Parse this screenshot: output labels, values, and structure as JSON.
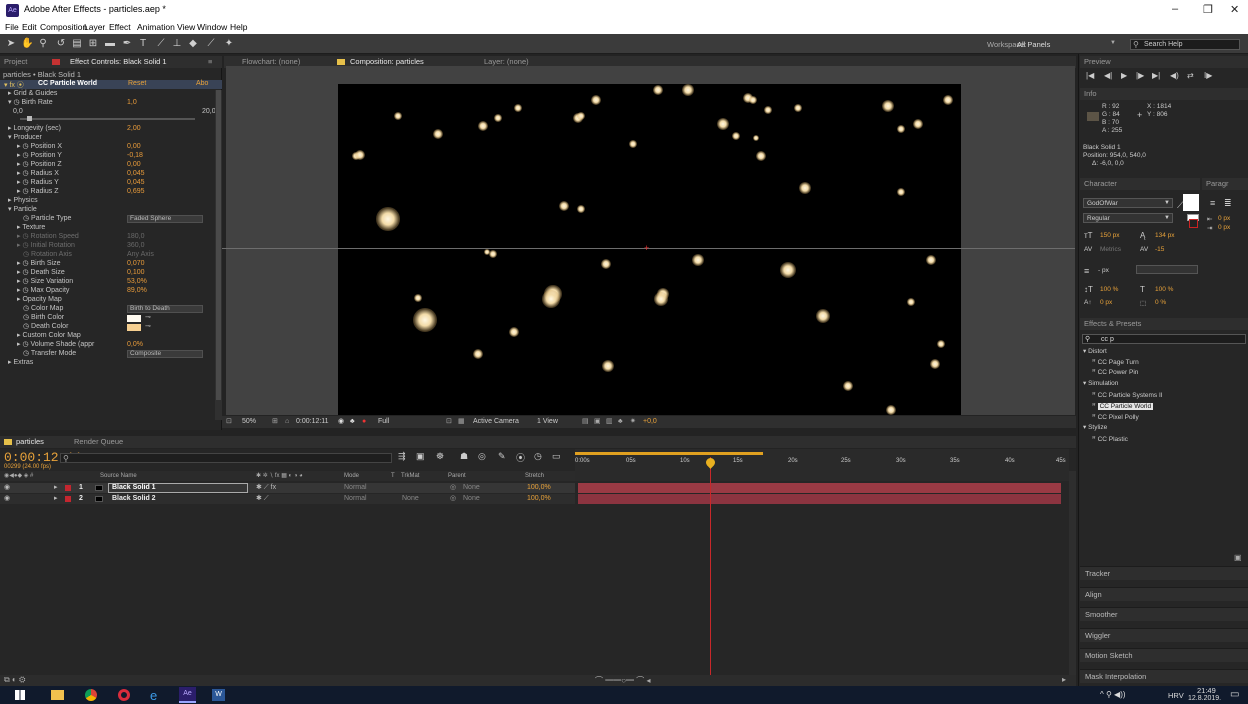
{
  "window": {
    "title": "Adobe After Effects - particles.aep *",
    "minimize": "–",
    "maximize": "❐",
    "close": "✕"
  },
  "menu": [
    "File",
    "Edit",
    "Composition",
    "Layer",
    "Effect",
    "Animation",
    "View",
    "Window",
    "Help"
  ],
  "toolbar": {
    "workspace_label": "Workspace:",
    "workspace_value": "All Panels",
    "search_placeholder": "Search Help"
  },
  "effect_controls": {
    "tab_project": "Project",
    "tab_title": "Effect Controls: Black Solid 1",
    "breadcrumb": "particles • Black Solid 1",
    "effect_name": "CC Particle World",
    "reset": "Reset",
    "about": "Abo",
    "rows": [
      {
        "label": "▸ Grid & Guides",
        "value": ""
      },
      {
        "label": "▾ ◷ Birth Rate",
        "value": "1,0"
      },
      {
        "label": "0,0",
        "value": "20,0"
      },
      {
        "label": "",
        "value": ""
      },
      {
        "label": "▸ Longevity (sec)",
        "value": "2,00"
      },
      {
        "label": "▾ Producer",
        "value": ""
      },
      {
        "label": "▸ ◷ Position X",
        "value": "0,00"
      },
      {
        "label": "▸ ◷ Position Y",
        "value": "-0,18"
      },
      {
        "label": "▸ ◷ Position Z",
        "value": "0,00"
      },
      {
        "label": "▸ ◷ Radius X",
        "value": "0,045"
      },
      {
        "label": "▸ ◷ Radius Y",
        "value": "0,045"
      },
      {
        "label": "▸ ◷ Radius Z",
        "value": "0,695"
      },
      {
        "label": "▸ Physics",
        "value": ""
      },
      {
        "label": "▾ Particle",
        "value": ""
      },
      {
        "label": "◷ Particle Type",
        "value": "Faded Sphere"
      },
      {
        "label": "▸ Texture",
        "value": ""
      },
      {
        "label": "▸ ◷ Rotation Speed",
        "value": "180,0"
      },
      {
        "label": "▸ ◷ Initial Rotation",
        "value": "360,0"
      },
      {
        "label": "◷ Rotation Axis",
        "value": "Any Axis"
      },
      {
        "label": "▸ ◷ Birth Size",
        "value": "0,070"
      },
      {
        "label": "▸ ◷ Death Size",
        "value": "0,100"
      },
      {
        "label": "▸ ◷ Size Variation",
        "value": "53,0%"
      },
      {
        "label": "▸ ◷ Max Opacity",
        "value": "89,0%"
      },
      {
        "label": "▸ Opacity Map",
        "value": ""
      },
      {
        "label": "◷ Color Map",
        "value": "Birth to Death"
      },
      {
        "label": "◷ Birth Color",
        "value": ""
      },
      {
        "label": "◷ Death Color",
        "value": ""
      },
      {
        "label": "▸ Custom Color Map",
        "value": ""
      },
      {
        "label": "▸ ◷ Volume Shade (appr",
        "value": "0,0%"
      },
      {
        "label": "◷ Transfer Mode",
        "value": "Composite"
      },
      {
        "label": "▸ Extras",
        "value": ""
      }
    ],
    "birth_color": "#fffaf0",
    "death_color": "#f6cf90"
  },
  "viewer": {
    "tab_flowchart": "Flowchart: (none)",
    "tab_composition": "Composition: particles",
    "tab_layer": "Layer: (none)",
    "comp_tab": "particles",
    "zoom": "50%",
    "timecode": "0:00:12:11",
    "resolution": "Full",
    "camera": "Active Camera",
    "view": "1 View",
    "exposure": "+0,0"
  },
  "timeline": {
    "tab": "particles",
    "tab_render": "Render Queue",
    "timecode": "0:00:12:11",
    "frames": "00299 (24.00 fps)",
    "col_source": "Source Name",
    "col_mode": "Mode",
    "col_t": "T",
    "col_trkmat": "TrkMat",
    "col_parent": "Parent",
    "col_stretch": "Stretch",
    "ruler": [
      "0:00s",
      "05s",
      "10s",
      "15s",
      "20s",
      "25s",
      "30s",
      "35s",
      "40s",
      "45s"
    ],
    "playhead_seconds": 12.46,
    "layers": [
      {
        "num": "1",
        "name": "Black Solid 1",
        "mode": "Normal",
        "trkmat": "",
        "parent": "None",
        "stretch": "100,0%"
      },
      {
        "num": "2",
        "name": "Black Solid 2",
        "mode": "Normal",
        "trkmat": "None",
        "parent": "None",
        "stretch": "100,0%"
      }
    ]
  },
  "info": {
    "tab_preview": "Preview",
    "tab": "Info",
    "r": "R : 92",
    "g": "G : 84",
    "b": "B : 70",
    "a": "A : 255",
    "x": "X : 1814",
    "y": "Y : 806",
    "layer": "Black Solid 1",
    "position": "Position: 954,0, 540,0",
    "delta": "Δ: -6,0, 0,0"
  },
  "character": {
    "tab": "Character",
    "tab_paragraph": "Paragr",
    "font": "GodOfWar",
    "style": "Regular",
    "size": "150 px",
    "leading": "134 px",
    "kerning": "Metrics",
    "tracking": "-15",
    "stroke": "- px",
    "vscale": "100 %",
    "hscale": "100 %",
    "baseline": "0 px",
    "tsume": "0 %",
    "para_a": "0 px",
    "para_b": "0 px"
  },
  "effects_presets": {
    "tab": "Effects & Presets",
    "search": "cc p",
    "groups": [
      {
        "name": "▾ Distort",
        "items": [
          "CC Page Turn",
          "CC Power Pin"
        ]
      },
      {
        "name": "▾ Simulation",
        "items": [
          "CC Particle Systems II",
          "CC Particle World"
        ]
      },
      {
        "name": "▾ Stylize",
        "items": [
          "CC Pixel Polly",
          "CC Plastic"
        ]
      }
    ],
    "selected": "CC Particle World"
  },
  "collapsed_panels": [
    "Tracker",
    "Align",
    "Smoother",
    "Wiggler",
    "Motion Sketch",
    "Mask Interpolation"
  ],
  "taskbar": {
    "lang": "HRV",
    "time": "21:49",
    "date": "12.8.2019."
  },
  "colors": {
    "accent": "#e8a23a",
    "playhead": "#c8282a",
    "layer_bar": "#9a3a44"
  }
}
